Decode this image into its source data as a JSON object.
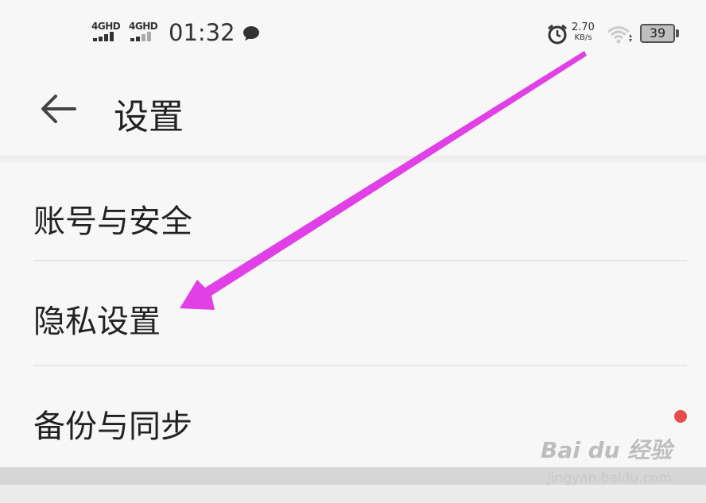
{
  "status_bar": {
    "signal_1": "4GHD",
    "signal_2": "4GHD",
    "time": "01:32",
    "net_speed_value": "2.70",
    "net_speed_unit": "KB/s",
    "battery_level": "39"
  },
  "header": {
    "title": "设置"
  },
  "settings": {
    "items": [
      {
        "label": "账号与安全"
      },
      {
        "label": "隐私设置"
      },
      {
        "label": "备份与同步"
      }
    ]
  },
  "annotation": {
    "arrow_color": "#e040e6"
  },
  "watermark": {
    "logo_text": "Bai du 经验",
    "url": "jingyan.baidu.com"
  }
}
